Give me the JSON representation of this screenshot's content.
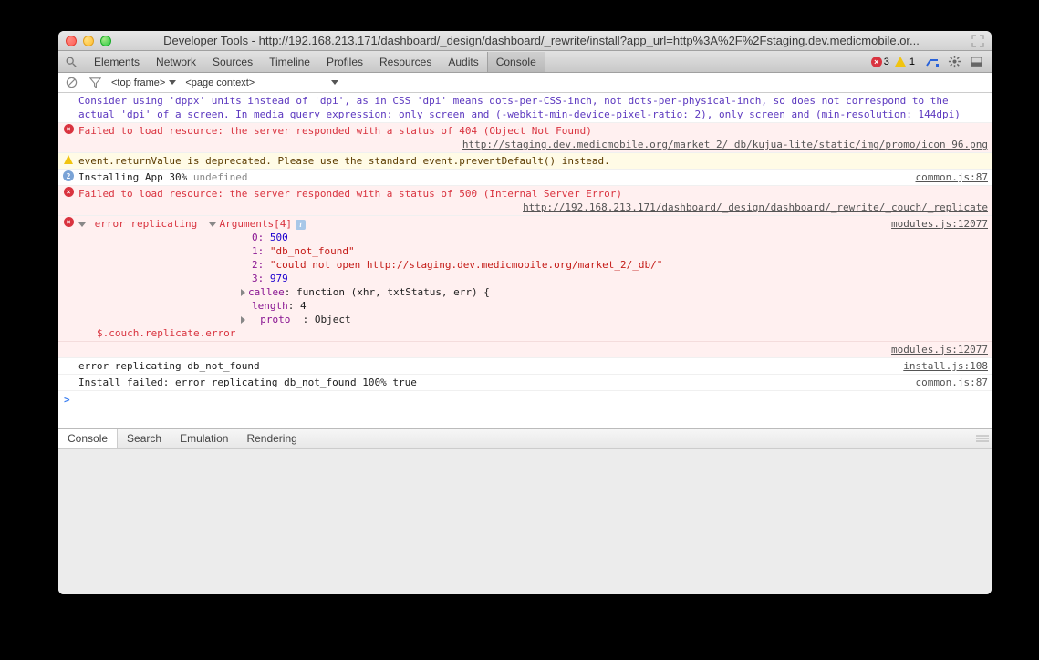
{
  "window": {
    "title": "Developer Tools - http://192.168.213.171/dashboard/_design/dashboard/_rewrite/install?app_url=http%3A%2F%2Fstaging.dev.medicmobile.or..."
  },
  "toolbar": {
    "tabs": [
      "Elements",
      "Network",
      "Sources",
      "Timeline",
      "Profiles",
      "Resources",
      "Audits",
      "Console"
    ],
    "active_tab": "Console",
    "error_count": "3",
    "warn_count": "1"
  },
  "subbar": {
    "frame_selector": "<top frame>",
    "context_selector": "<page context>"
  },
  "logs": {
    "violet_msg": "Consider using 'dppx' units instead of 'dpi', as in CSS 'dpi' means dots-per-CSS-inch, not dots-per-physical-inch, so does not correspond to the actual 'dpi' of a screen. In media query expression: only screen and (-webkit-min-device-pixel-ratio: 2), only screen and (min-resolution: 144dpi)",
    "err404": "Failed to load resource: the server responded with a status of 404 (Object Not Found)",
    "err404_src": "http://staging.dev.medicmobile.org/market_2/_db/kujua-lite/static/img/promo/icon_96.png",
    "warn_deprec": "event.returnValue is deprecated. Please use the standard event.preventDefault() instead.",
    "install_count": "2",
    "install_msg": "Installing App 30%",
    "install_undef": " undefined",
    "install_src": "common.js:87",
    "err500": "Failed to load resource: the server responded with a status of 500 (Internal Server Error)",
    "err500_src": "http://192.168.213.171/dashboard/_design/dashboard/_rewrite/_couch/_replicate",
    "replicating_label": "error replicating",
    "args_label": "Arguments[4]",
    "arg0_k": "0: ",
    "arg0_v": "500",
    "arg1_k": "1: ",
    "arg1_v": "\"db_not_found\"",
    "arg2_k": "2: ",
    "arg2_v": "\"could not open http://staging.dev.medicmobile.org/market_2/_db/\"",
    "arg3_k": "3: ",
    "arg3_v": "979",
    "callee_k": "callee",
    "callee_v": ": function (xhr, txtStatus, err) {",
    "length_k": "length",
    "length_v": ": 4",
    "proto_k": "__proto__",
    "proto_v": ": Object",
    "couch_err": "$.couch.replicate.error",
    "replicating_src": "modules.js:12077",
    "line_err_rep": "error replicating db_not_found",
    "line_err_rep_src": "install.js:108",
    "line_fail": "Install failed: error replicating db_not_found 100% true",
    "line_fail_src": "common.js:87"
  },
  "drawer": {
    "tabs": [
      "Console",
      "Search",
      "Emulation",
      "Rendering"
    ],
    "active": "Console"
  }
}
